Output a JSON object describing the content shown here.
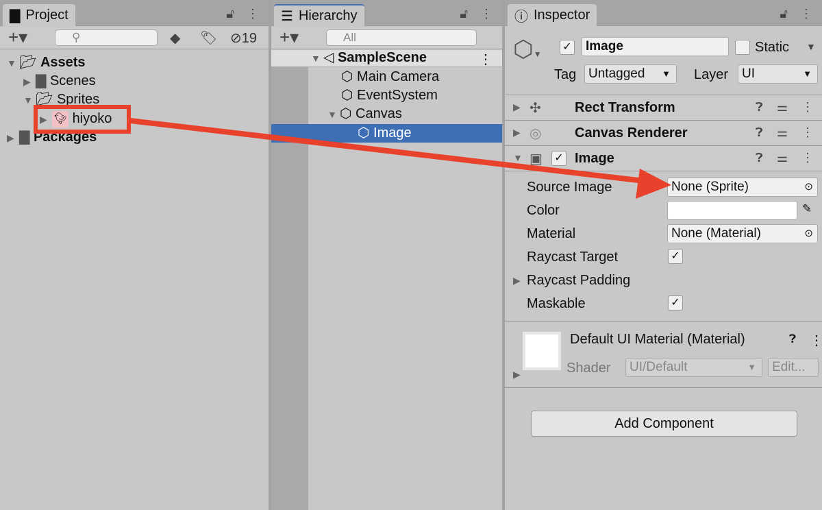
{
  "project": {
    "tab": "Project",
    "hidden_count": "19",
    "tree": [
      {
        "label": "Assets",
        "expanded": true
      },
      {
        "label": "Scenes"
      },
      {
        "label": "Sprites",
        "expanded": true
      },
      {
        "label": "hiyoko"
      },
      {
        "label": "Packages"
      }
    ]
  },
  "hierarchy": {
    "tab": "Hierarchy",
    "search_placeholder": "All",
    "scene": "SampleScene",
    "items": [
      "Main Camera",
      "EventSystem",
      "Canvas",
      "Image"
    ]
  },
  "inspector": {
    "tab": "Inspector",
    "object_name": "Image",
    "static_label": "Static",
    "tag_label": "Tag",
    "tag_value": "Untagged",
    "layer_label": "Layer",
    "layer_value": "UI",
    "components": [
      "Rect Transform",
      "Canvas Renderer",
      "Image"
    ],
    "fields": {
      "source_image_label": "Source Image",
      "source_image_value": "None (Sprite)",
      "color_label": "Color",
      "material_label": "Material",
      "material_value": "None (Material)",
      "raycast_target_label": "Raycast Target",
      "raycast_padding_label": "Raycast Padding",
      "maskable_label": "Maskable"
    },
    "material": {
      "name": "Default UI Material (Material)",
      "shader_label": "Shader",
      "shader_value": "UI/Default",
      "edit_label": "Edit..."
    },
    "add_component": "Add Component"
  },
  "colors": {
    "selection": "#3e6fb5",
    "annotation": "#e8412c"
  }
}
